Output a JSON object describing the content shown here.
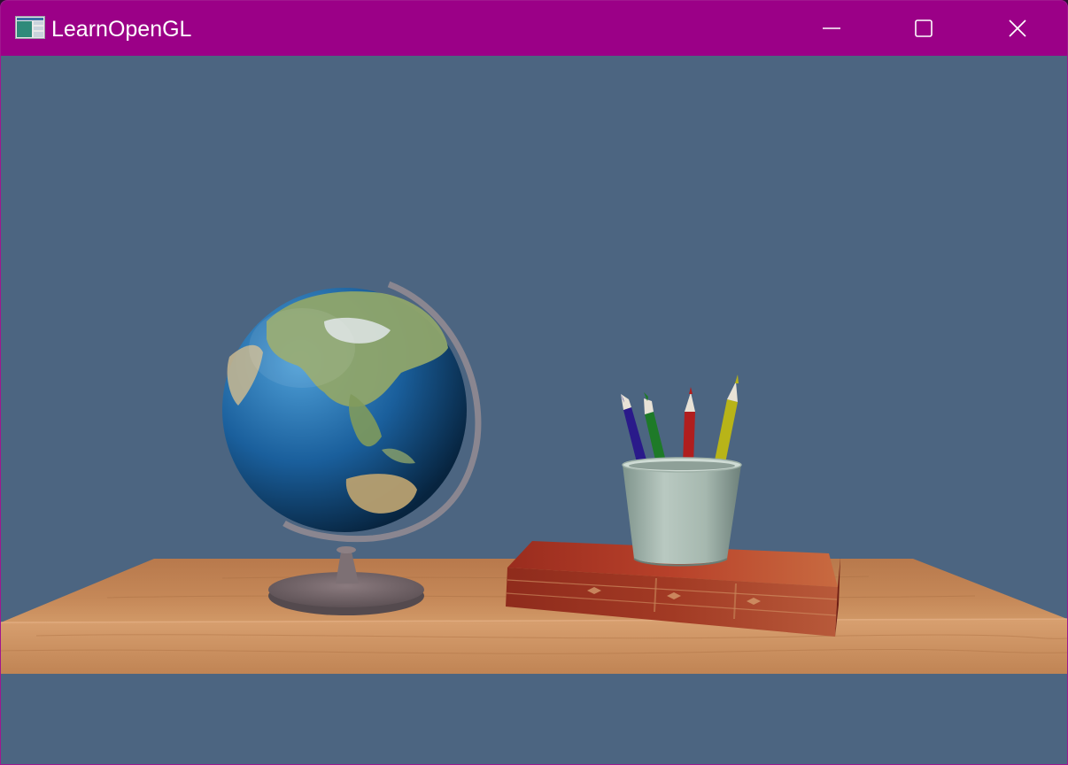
{
  "window": {
    "title": "LearnOpenGL",
    "titlebar_color": "#9b0087",
    "controls": [
      {
        "name": "minimize",
        "icon": "minimize-icon"
      },
      {
        "name": "maximize",
        "icon": "maximize-icon"
      },
      {
        "name": "close",
        "icon": "close-icon"
      }
    ]
  },
  "scene": {
    "clear_color": "#4c6581",
    "objects": [
      "desk",
      "globe",
      "book",
      "pencil-cup",
      "pencils"
    ],
    "pencil_colors": [
      "#2a1a8a",
      "#1e7a28",
      "#b01e1e",
      "#b8b418"
    ]
  }
}
